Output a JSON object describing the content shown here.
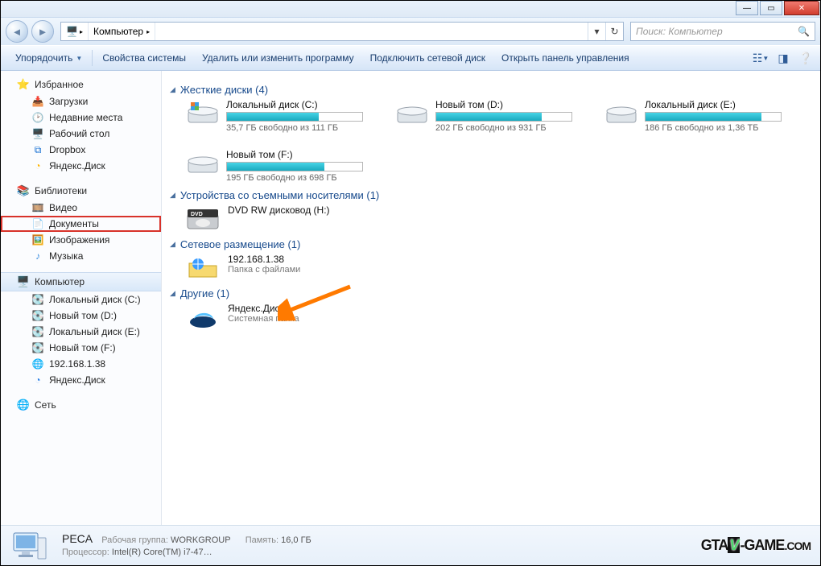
{
  "breadcrumb": {
    "label": "Компьютер"
  },
  "search": {
    "placeholder": "Поиск: Компьютер"
  },
  "toolbar": {
    "organize": "Упорядочить",
    "props": "Свойства системы",
    "uninstall": "Удалить или изменить программу",
    "mapdrive": "Подключить сетевой диск",
    "controlpanel": "Открыть панель управления"
  },
  "sidebar": {
    "favorites": {
      "label": "Избранное",
      "items": [
        "Загрузки",
        "Недавние места",
        "Рабочий стол",
        "Dropbox",
        "Яндекс.Диск"
      ]
    },
    "libraries": {
      "label": "Библиотеки",
      "items": [
        "Видео",
        "Документы",
        "Изображения",
        "Музыка"
      ]
    },
    "computer": {
      "label": "Компьютер",
      "items": [
        "Локальный диск (C:)",
        "Новый том (D:)",
        "Локальный диск (E:)",
        "Новый том (F:)",
        "192.168.1.38",
        "Яндекс.Диск"
      ]
    },
    "network": {
      "label": "Сеть"
    }
  },
  "groups": {
    "hdd": {
      "label": "Жесткие диски (4)"
    },
    "removable": {
      "label": "Устройства со съемными носителями (1)"
    },
    "network": {
      "label": "Сетевое размещение (1)"
    },
    "other": {
      "label": "Другие (1)"
    }
  },
  "drives": [
    {
      "name": "Локальный диск (C:)",
      "free": "35,7 ГБ свободно из 111 ГБ",
      "fill_pct": 68
    },
    {
      "name": "Новый том (D:)",
      "free": "202 ГБ свободно из 931 ГБ",
      "fill_pct": 78
    },
    {
      "name": "Локальный диск (E:)",
      "free": "186 ГБ свободно из 1,36 ТБ",
      "fill_pct": 86
    },
    {
      "name": "Новый том (F:)",
      "free": "195 ГБ свободно из 698 ГБ",
      "fill_pct": 72
    }
  ],
  "dvd": {
    "name": "DVD RW дисковод (H:)"
  },
  "netloc": {
    "name": "192.168.1.38",
    "sub": "Папка с файлами"
  },
  "yadisk": {
    "name": "Яндекс.Диск",
    "sub": "Системная папка"
  },
  "status": {
    "pcname": "PECA",
    "workgroup_label": "Рабочая группа:",
    "workgroup": "WORKGROUP",
    "mem_label": "Память:",
    "mem": "16,0 ГБ",
    "cpu_label": "Процессор:",
    "cpu": "Intel(R) Core(TM) i7-47…"
  },
  "watermark": {
    "a": "GTA",
    "b": "-GAME",
    "c": ".COM"
  }
}
